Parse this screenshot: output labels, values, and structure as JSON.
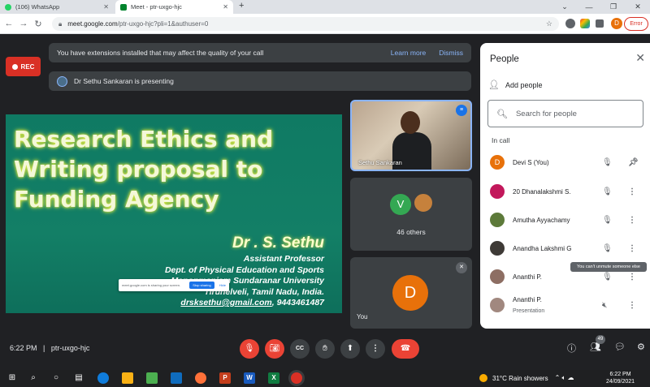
{
  "browser": {
    "tabs": [
      {
        "label": "(106) WhatsApp",
        "color": "#25d366"
      },
      {
        "label": "Meet - ptr-uxgo-hjc",
        "color": "#00832d"
      }
    ],
    "new_tab": "+",
    "window_buttons": [
      "⌄",
      "—",
      "❐",
      "✕"
    ],
    "url_host": "meet.google.com",
    "url_path": "/ptr-uxgo-hjc?pli=1&authuser=0",
    "profile_initial": "D",
    "error_label": "Error"
  },
  "meet": {
    "rec_label": "REC",
    "extension_banner": {
      "message": "You have extensions installed that may affect the quality of your call",
      "learn_more": "Learn more",
      "dismiss": "Dismiss"
    },
    "presenting_text": "Dr Sethu Sankaran is presenting",
    "slide": {
      "title": "Research Ethics and Writing proposal to Funding Agency",
      "author": "Dr . S. Sethu",
      "lines": [
        "Assistant Professor",
        "Dept. of Physical Education and Sports",
        "Manonmaniam Sundaranar University",
        "Tirunelveli, Tamil Nadu, India."
      ],
      "email": "drsksethu@gmail.com",
      "phone": ", 9443461487"
    },
    "share_bar": {
      "text": "meet.google.com is sharing your screen.",
      "stop": "Stop sharing",
      "hide": "Hide"
    },
    "tiles": {
      "presenter_name": "Sethu Sankaran",
      "others_initial": "V",
      "others_count": "46 others",
      "self_initial": "D",
      "self_label": "You"
    },
    "people_panel": {
      "title": "People",
      "add_people": "Add people",
      "search_placeholder": "Search for people",
      "section": "In call",
      "participants": [
        {
          "name": "Devi S (You)",
          "initial": "D",
          "color": "#e8710a",
          "sub": ""
        },
        {
          "name": "20 Dhanalakshmi S.",
          "initial": "",
          "color": "#c2185b",
          "sub": ""
        },
        {
          "name": "Amutha Ayyachamy",
          "initial": "",
          "color": "#5d7a3a",
          "sub": ""
        },
        {
          "name": "Anandha Lakshmi G",
          "initial": "",
          "color": "#3e3a36",
          "sub": ""
        },
        {
          "name": "Ananthi P.",
          "initial": "",
          "color": "#8d6e63",
          "sub": ""
        },
        {
          "name": "Ananthi P.",
          "initial": "",
          "color": "#a1887f",
          "sub": "Presentation"
        }
      ],
      "tooltip": "You can't unmute someone else"
    },
    "bottom_bar": {
      "time": "6:22 PM",
      "separator": "|",
      "meeting_code": "ptr-uxgo-hjc",
      "people_count": "49"
    }
  },
  "taskbar": {
    "weather": "31°C  Rain showers",
    "time": "6:22 PM",
    "date": "24/09/2021"
  }
}
